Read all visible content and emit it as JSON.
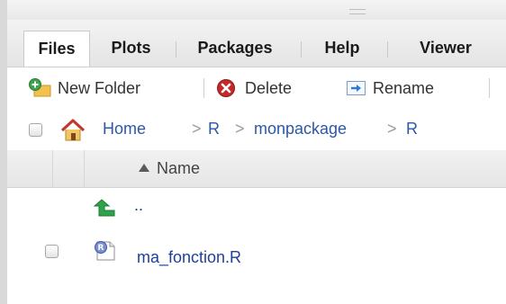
{
  "tabs": [
    {
      "label": "Files",
      "active": true
    },
    {
      "label": "Plots",
      "active": false
    },
    {
      "label": "Packages",
      "active": false
    },
    {
      "label": "Help",
      "active": false
    },
    {
      "label": "Viewer",
      "active": false
    }
  ],
  "toolbar": {
    "new_folder_label": "New Folder",
    "delete_label": "Delete",
    "rename_label": "Rename"
  },
  "breadcrumb": [
    "Home",
    "R",
    "monpackage",
    "R"
  ],
  "breadcrumb_separator": ">",
  "table": {
    "column_name": "Name",
    "sort": "ascending",
    "parent_label": "..",
    "files": [
      {
        "name": "ma_fonction.R",
        "icon": "r-file-icon"
      }
    ]
  },
  "colors": {
    "link": "#2c58a8",
    "file_link": "#1f3f9c",
    "parent_arrow": "#2fa34a",
    "delete_red": "#c62828",
    "home_red": "#c0392b"
  }
}
